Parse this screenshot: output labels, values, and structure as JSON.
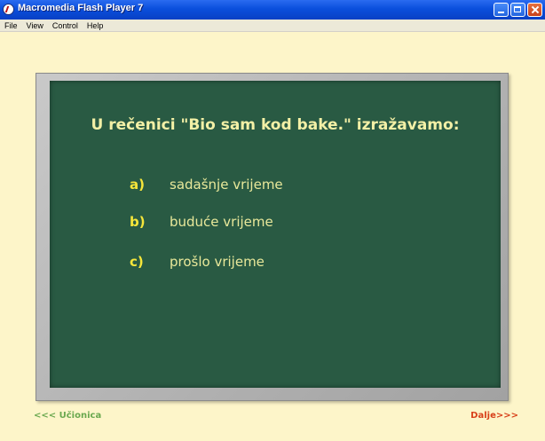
{
  "window": {
    "title": "Macromedia Flash Player 7",
    "icon": "flash-player-icon"
  },
  "menu": [
    "File",
    "View",
    "Control",
    "Help"
  ],
  "question": "U rečenici \"Bio sam kod bake.\" izražavamo:",
  "answers": [
    {
      "letter": "a)",
      "text": "sadašnje vrijeme"
    },
    {
      "letter": "b)",
      "text": "buduće vrijeme"
    },
    {
      "letter": "c)",
      "text": "prošlo vrijeme"
    }
  ],
  "nav": {
    "back": "<<< Učionica",
    "next": "Dalje>>>"
  },
  "colors": {
    "background": "#fdf5c9",
    "board": "#295a43",
    "question_text": "#f3f0a6",
    "answer_letter": "#f6e63a",
    "answer_text": "#e8e89a",
    "nav_back": "#6aa84f",
    "nav_next": "#d8401a"
  }
}
